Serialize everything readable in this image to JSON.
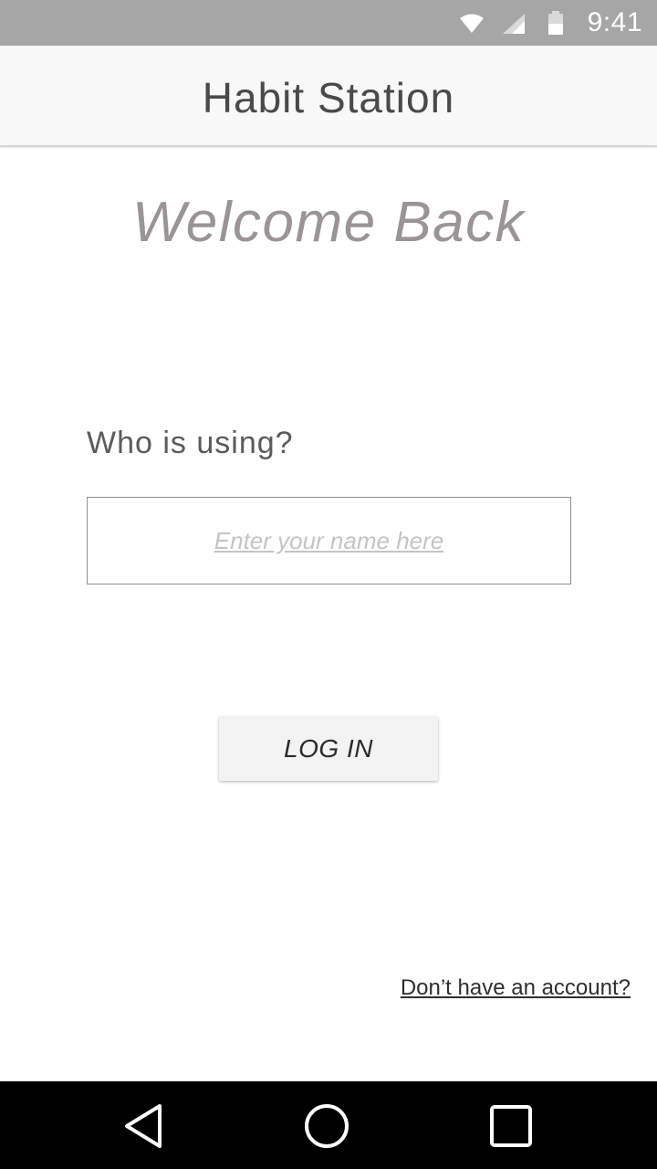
{
  "status_bar": {
    "time": "9:41",
    "icons": [
      "wifi-icon",
      "signal-icon",
      "battery-icon"
    ]
  },
  "app_bar": {
    "title": "Habit Station"
  },
  "main": {
    "welcome_heading": "Welcome Back",
    "who_label": "Who is using?",
    "name_input": {
      "value": "",
      "placeholder": "Enter your name here"
    },
    "login_button_label": "LOG IN",
    "signup_link": "Don’t have an account?"
  },
  "nav_bar": {
    "buttons": [
      "back-icon",
      "home-icon",
      "recents-icon"
    ]
  },
  "colors": {
    "status_bar_bg": "#a6a6a6",
    "app_bar_bg": "#f8f8f8",
    "welcome_text": "#9a9494",
    "nav_bar_bg": "#000000",
    "button_bg": "#f3f3f3"
  }
}
